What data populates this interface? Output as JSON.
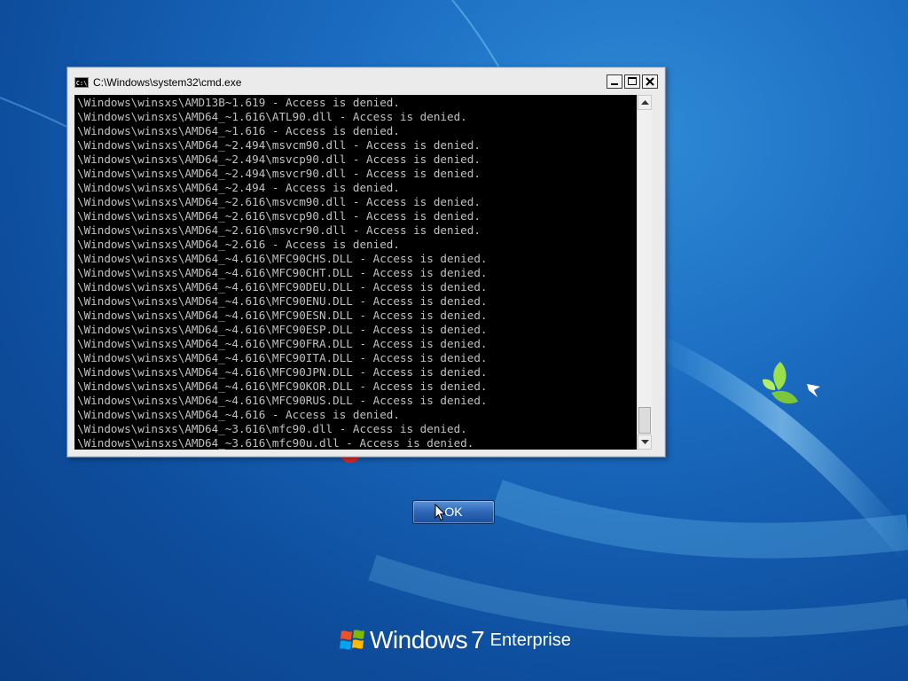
{
  "window": {
    "title": "C:\\Windows\\system32\\cmd.exe",
    "icon_label": "C:\\"
  },
  "console": {
    "lines": [
      "\\Windows\\winsxs\\AMD13B~1.619 - Access is denied.",
      "\\Windows\\winsxs\\AMD64_~1.616\\ATL90.dll - Access is denied.",
      "\\Windows\\winsxs\\AMD64_~1.616 - Access is denied.",
      "\\Windows\\winsxs\\AMD64_~2.494\\msvcm90.dll - Access is denied.",
      "\\Windows\\winsxs\\AMD64_~2.494\\msvcp90.dll - Access is denied.",
      "\\Windows\\winsxs\\AMD64_~2.494\\msvcr90.dll - Access is denied.",
      "\\Windows\\winsxs\\AMD64_~2.494 - Access is denied.",
      "\\Windows\\winsxs\\AMD64_~2.616\\msvcm90.dll - Access is denied.",
      "\\Windows\\winsxs\\AMD64_~2.616\\msvcp90.dll - Access is denied.",
      "\\Windows\\winsxs\\AMD64_~2.616\\msvcr90.dll - Access is denied.",
      "\\Windows\\winsxs\\AMD64_~2.616 - Access is denied.",
      "\\Windows\\winsxs\\AMD64_~4.616\\MFC90CHS.DLL - Access is denied.",
      "\\Windows\\winsxs\\AMD64_~4.616\\MFC90CHT.DLL - Access is denied.",
      "\\Windows\\winsxs\\AMD64_~4.616\\MFC90DEU.DLL - Access is denied.",
      "\\Windows\\winsxs\\AMD64_~4.616\\MFC90ENU.DLL - Access is denied.",
      "\\Windows\\winsxs\\AMD64_~4.616\\MFC90ESN.DLL - Access is denied.",
      "\\Windows\\winsxs\\AMD64_~4.616\\MFC90ESP.DLL - Access is denied.",
      "\\Windows\\winsxs\\AMD64_~4.616\\MFC90FRA.DLL - Access is denied.",
      "\\Windows\\winsxs\\AMD64_~4.616\\MFC90ITA.DLL - Access is denied.",
      "\\Windows\\winsxs\\AMD64_~4.616\\MFC90JPN.DLL - Access is denied.",
      "\\Windows\\winsxs\\AMD64_~4.616\\MFC90KOR.DLL - Access is denied.",
      "\\Windows\\winsxs\\AMD64_~4.616\\MFC90RUS.DLL - Access is denied.",
      "\\Windows\\winsxs\\AMD64_~4.616 - Access is denied.",
      "\\Windows\\winsxs\\AMD64_~3.616\\mfc90.dll - Access is denied.",
      "\\Windows\\winsxs\\AMD64_~3.616\\mfc90u.dll - Access is denied."
    ]
  },
  "dialog": {
    "ok_label": "OK"
  },
  "branding": {
    "word": "Windows",
    "version": "7",
    "edition": "Enterprise"
  },
  "colors": {
    "console_bg": "#000000",
    "console_text": "#c0c0c0",
    "desktop_bg": "#1a6bc0",
    "ok_button": "#2c66b6"
  }
}
